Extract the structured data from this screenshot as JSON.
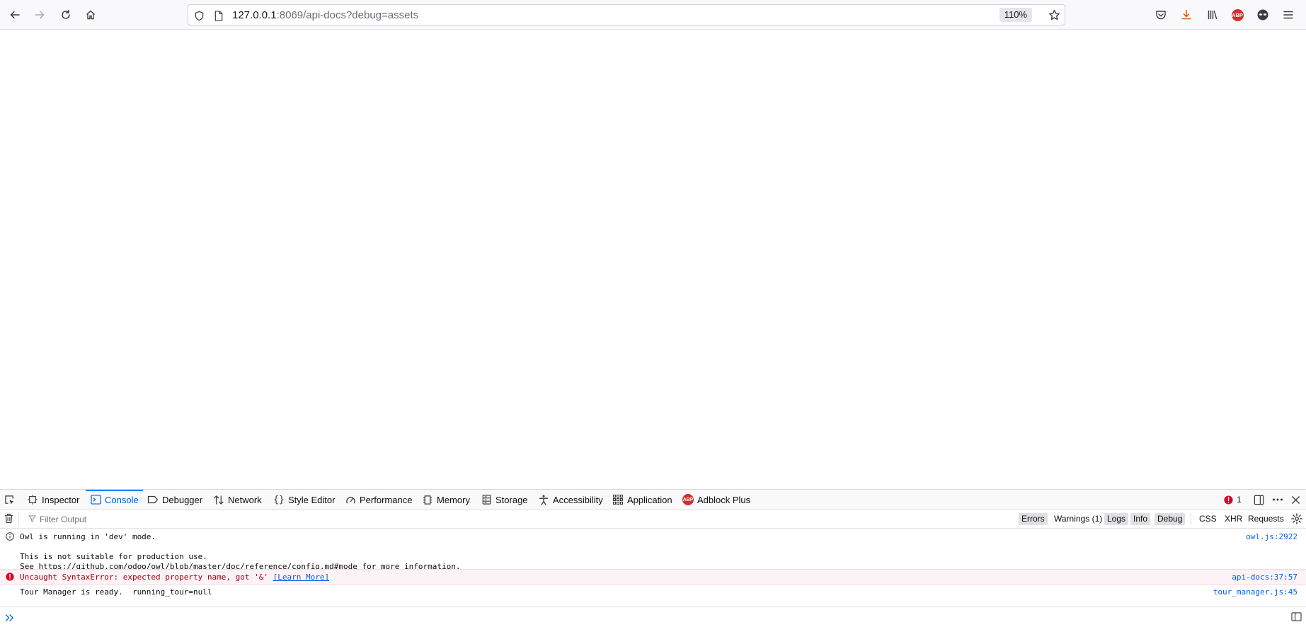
{
  "url": {
    "host": "127.0.0.1",
    "rest": ":8069/api-docs?debug=assets",
    "zoom": "110%"
  },
  "toolbar": {
    "abp_label": "ABP"
  },
  "devtools": {
    "tabs": [
      {
        "label": "Inspector",
        "icon": "inspector-icon"
      },
      {
        "label": "Console",
        "icon": "console-icon"
      },
      {
        "label": "Debugger",
        "icon": "debugger-icon"
      },
      {
        "label": "Network",
        "icon": "network-icon"
      },
      {
        "label": "Style Editor",
        "icon": "style-editor-icon"
      },
      {
        "label": "Performance",
        "icon": "performance-icon"
      },
      {
        "label": "Memory",
        "icon": "memory-icon"
      },
      {
        "label": "Storage",
        "icon": "storage-icon"
      },
      {
        "label": "Accessibility",
        "icon": "accessibility-icon"
      },
      {
        "label": "Application",
        "icon": "application-icon"
      },
      {
        "label": "Adblock Plus",
        "icon": "adblock-plus-icon"
      }
    ],
    "active_tab": "Console",
    "error_count": "1",
    "filter_placeholder": "Filter Output",
    "filters": {
      "errors": "Errors",
      "warnings": "Warnings (1)",
      "logs": "Logs",
      "info": "Info",
      "debug": "Debug",
      "css": "CSS",
      "xhr": "XHR",
      "requests": "Requests"
    },
    "messages": [
      {
        "type": "info",
        "lines": [
          "Owl is running in 'dev' mode.",
          "",
          "This is not suitable for production use.",
          "See https://github.com/odoo/owl/blob/master/doc/reference/config.md#mode for more information."
        ],
        "source": "owl.js:2922"
      },
      {
        "type": "error",
        "text": "Uncaught SyntaxError: expected property name, got '&'",
        "link": "[Learn More]",
        "source": "api-docs:37:57"
      },
      {
        "type": "log",
        "text": "Tour Manager is ready.  running_tour=null",
        "source": "tour_manager.js:45"
      }
    ]
  },
  "colors": {
    "accent": "#0060df",
    "error": "#a4000f",
    "error_bg": "#fdf2f5",
    "abp": "#d32f2f"
  }
}
